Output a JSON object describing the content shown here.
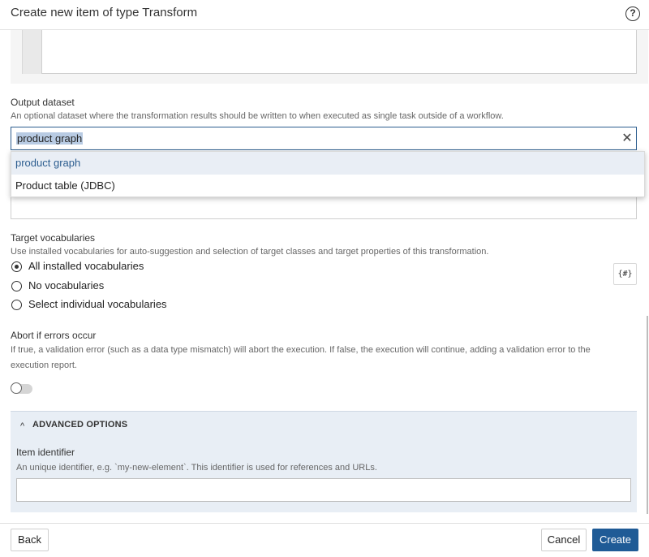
{
  "header": {
    "title": "Create new item of type Transform",
    "help_icon": "?"
  },
  "output_dataset": {
    "label": "Output dataset",
    "help": "An optional dataset where the transformation results should be written to when executed as single task outside of a workflow.",
    "value": "product graph",
    "clear_icon": "✕",
    "options": [
      "product graph",
      "Product table (JDBC)"
    ]
  },
  "target_vocabularies": {
    "label": "Target vocabularies",
    "help": "Use installed vocabularies for auto-suggestion and selection of target classes and target properties of this transformation.",
    "options": [
      {
        "label": "All installed vocabularies",
        "checked": true
      },
      {
        "label": "No vocabularies",
        "checked": false
      },
      {
        "label": "Select individual vocabularies",
        "checked": false
      }
    ],
    "template_button": "{#}"
  },
  "abort_on_errors": {
    "label": "Abort if errors occur",
    "help_line1": "If true, a validation error (such as a data type mismatch) will abort the execution. If false, the execution will continue, adding a validation error to the",
    "help_line2": "execution report.",
    "enabled": false
  },
  "advanced": {
    "title": "ADVANCED OPTIONS",
    "chevron_icon": "^",
    "item_identifier_label": "Item identifier",
    "item_identifier_help": "An unique identifier, e.g. `my-new-element`. This identifier is used for references and URLs.",
    "item_identifier_value": ""
  },
  "footer": {
    "back_label": "Back",
    "cancel_label": "Cancel",
    "create_label": "Create"
  },
  "colors": {
    "primary": "#1f5b96",
    "selection": "#b8cbe3",
    "advanced_bg": "#e8eef5"
  }
}
